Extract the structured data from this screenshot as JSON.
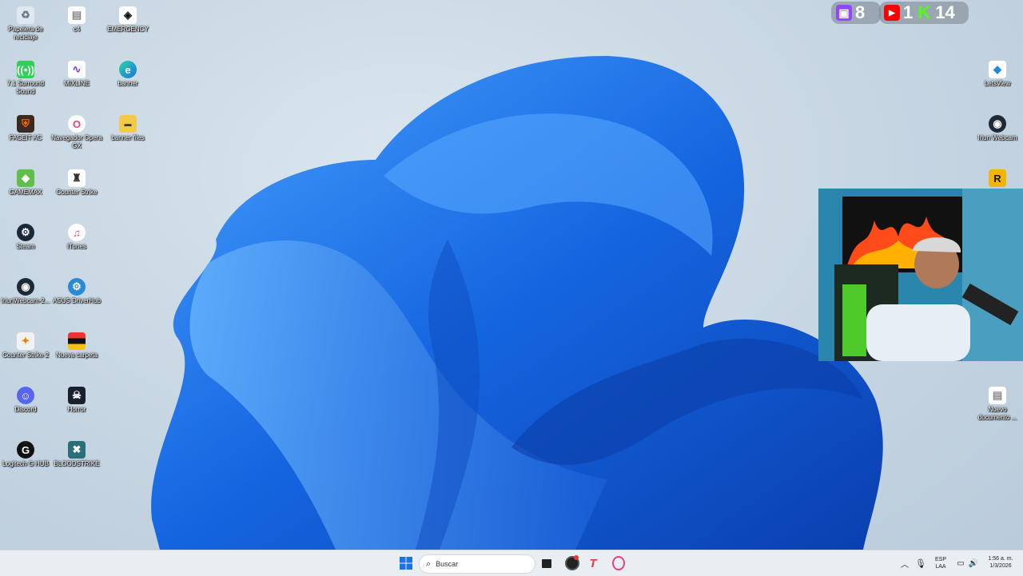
{
  "overlay": {
    "twitch_count": "8",
    "youtube_count": "1",
    "kick_count": "14",
    "kick_letter": "K"
  },
  "desktop_icons": {
    "recycle": "Papelera de reciclaje",
    "c4": "c4",
    "emergency": "EMERGENCY",
    "surround": "7.1 Surround Sound",
    "mixline": "MIXLINE",
    "banner": "banner",
    "faceit": "FACEIT AC",
    "opera": "Navegador Opera GX",
    "banner_files": "banner files",
    "gamemax": "GAMEMAX",
    "counter_strike": "Counter Strike",
    "steam": "Steam",
    "itunes": "iTunes",
    "iriun_webcam_2": "IriunWebcam-2...",
    "asus": "ASUS DriverHub",
    "cs2": "Counter Strike 2",
    "nueva_carpeta": "Nueva carpeta",
    "discord": "Discord",
    "horror": "Horror",
    "logitech": "Logitech G HUB",
    "bloodstrike": "BLOODSTRIKE",
    "letsview": "LetsView",
    "iriun_webcam": "Iriun Webcam",
    "nuevo_documento": "Nuevo documento ..."
  },
  "taskbar": {
    "search_placeholder": "Buscar",
    "lang_top": "ESP",
    "lang_bottom": "LAA",
    "time": "1:56 a. m.",
    "date": "1/3/2026"
  },
  "colors": {
    "wallpaper_bloom": "#1e6fe0",
    "twitch": "#9146ff",
    "youtube": "#ff0000",
    "kick": "#53fc18"
  }
}
